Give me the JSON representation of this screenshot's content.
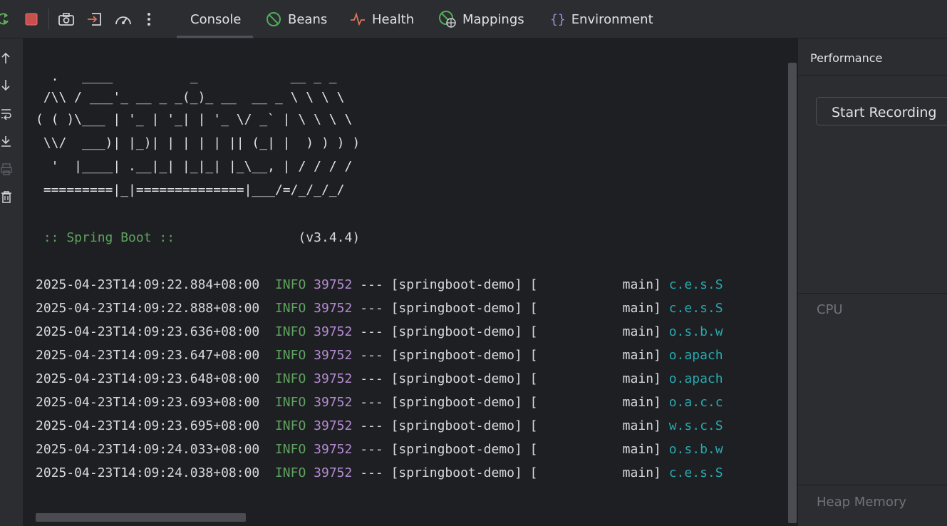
{
  "toolbar": {
    "icons": [
      "rerun-icon",
      "stop-icon",
      "camera-icon",
      "exit-icon",
      "gauge-icon",
      "more-icon"
    ],
    "tabs": [
      {
        "label": "Console",
        "icon": "none",
        "active": true
      },
      {
        "label": "Beans",
        "icon": "bean-icon",
        "color": "#4fae58"
      },
      {
        "label": "Health",
        "icon": "pulse-icon",
        "color": "#e0735b"
      },
      {
        "label": "Mappings",
        "icon": "globe-icon",
        "color": "#4fae58"
      },
      {
        "label": "Environment",
        "icon": "braces-icon",
        "color": "#a58bd6"
      }
    ]
  },
  "gutter": {
    "icons": [
      "arrow-up-icon",
      "arrow-down-icon",
      "soft-wrap-icon",
      "scroll-to-end-icon",
      "print-icon",
      "trash-icon"
    ]
  },
  "console": {
    "banner": [
      "  .   ____          _            __ _ _",
      " /\\\\ / ___'_ __ _ _(_)_ __  __ _ \\ \\ \\ \\",
      "( ( )\\___ | '_ | '_| | '_ \\/ _` | \\ \\ \\ \\",
      " \\\\/  ___)| |_)| | | | | || (_| |  ) ) ) )",
      "  '  |____| .__|_| |_|_| |_\\__, | / / / /",
      " =========|_|==============|___/=/_/_/_/"
    ],
    "spring_label": " :: Spring Boot ::",
    "spring_version": "(v3.4.4)",
    "log_lines": [
      {
        "ts": "2025-04-23T14:09:22.884+08:00",
        "level": "INFO",
        "pid": "39752",
        "sep": "---",
        "app": "[springboot-demo]",
        "thread": "[           main]",
        "logger": "c.e.s.S"
      },
      {
        "ts": "2025-04-23T14:09:22.888+08:00",
        "level": "INFO",
        "pid": "39752",
        "sep": "---",
        "app": "[springboot-demo]",
        "thread": "[           main]",
        "logger": "c.e.s.S"
      },
      {
        "ts": "2025-04-23T14:09:23.636+08:00",
        "level": "INFO",
        "pid": "39752",
        "sep": "---",
        "app": "[springboot-demo]",
        "thread": "[           main]",
        "logger": "o.s.b.w"
      },
      {
        "ts": "2025-04-23T14:09:23.647+08:00",
        "level": "INFO",
        "pid": "39752",
        "sep": "---",
        "app": "[springboot-demo]",
        "thread": "[           main]",
        "logger": "o.apach"
      },
      {
        "ts": "2025-04-23T14:09:23.648+08:00",
        "level": "INFO",
        "pid": "39752",
        "sep": "---",
        "app": "[springboot-demo]",
        "thread": "[           main]",
        "logger": "o.apach"
      },
      {
        "ts": "2025-04-23T14:09:23.693+08:00",
        "level": "INFO",
        "pid": "39752",
        "sep": "---",
        "app": "[springboot-demo]",
        "thread": "[           main]",
        "logger": "o.a.c.c"
      },
      {
        "ts": "2025-04-23T14:09:23.695+08:00",
        "level": "INFO",
        "pid": "39752",
        "sep": "---",
        "app": "[springboot-demo]",
        "thread": "[           main]",
        "logger": "w.s.c.S"
      },
      {
        "ts": "2025-04-23T14:09:24.033+08:00",
        "level": "INFO",
        "pid": "39752",
        "sep": "---",
        "app": "[springboot-demo]",
        "thread": "[           main]",
        "logger": "o.s.b.w"
      },
      {
        "ts": "2025-04-23T14:09:24.038+08:00",
        "level": "INFO",
        "pid": "39752",
        "sep": "---",
        "app": "[springboot-demo]",
        "thread": "[           main]",
        "logger": "c.e.s.S"
      }
    ]
  },
  "panel": {
    "title": "Performance",
    "record_button": "Start Recording",
    "cpu_label": "CPU",
    "heap_label": "Heap Memory"
  }
}
